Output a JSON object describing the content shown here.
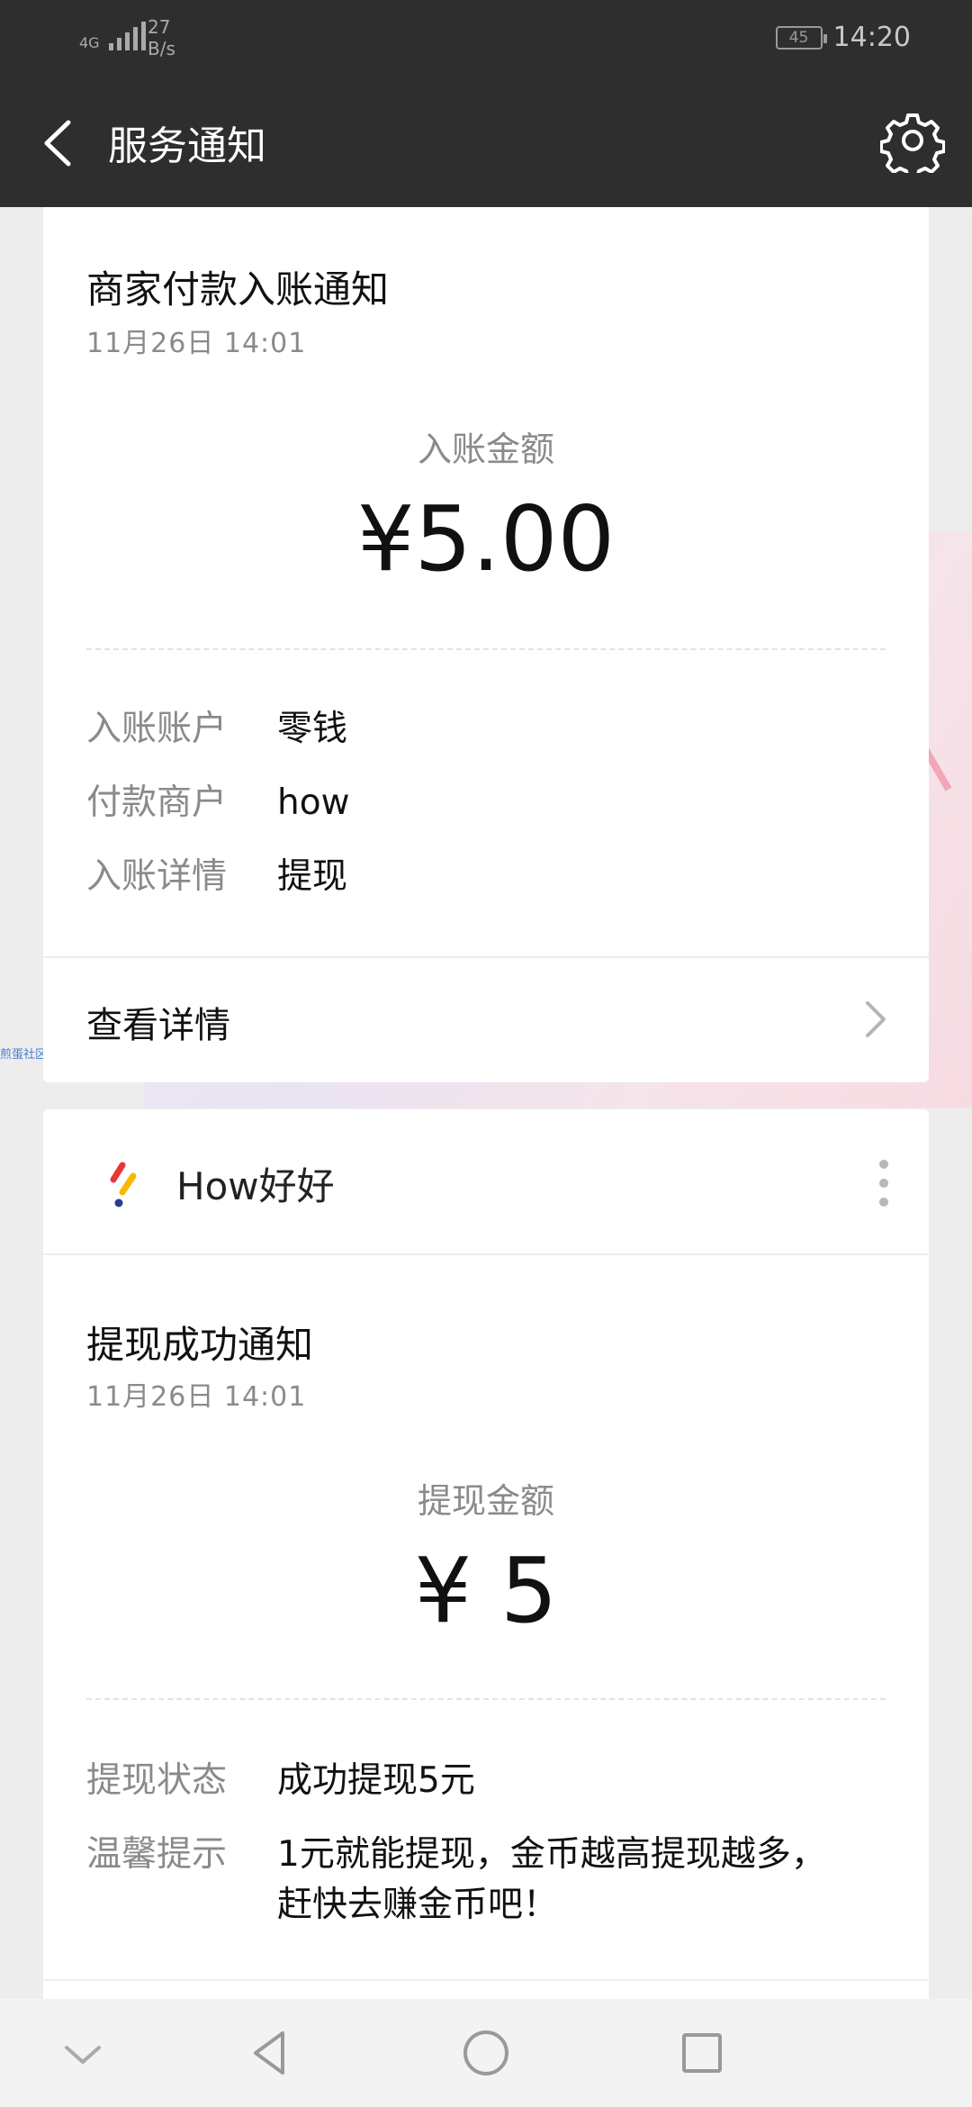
{
  "status_bar": {
    "network": "4G",
    "speed_value": "27",
    "speed_unit": "B/s",
    "battery": "45",
    "time": "14:20"
  },
  "header": {
    "title": "服务通知"
  },
  "card1": {
    "title": "商家付款入账通知",
    "date": "11月26日  14:01",
    "amount_label": "入账金额",
    "amount": "¥5.00",
    "fields": [
      {
        "key": "入账账户",
        "value": "零钱"
      },
      {
        "key": "付款商户",
        "value": "how"
      },
      {
        "key": "入账详情",
        "value": "提现"
      }
    ],
    "detail_link": "查看详情"
  },
  "card2": {
    "brand": "How好好",
    "title": "提现成功通知",
    "date": "11月26日  14:01",
    "amount_label": "提现金额",
    "amount": "¥ 5",
    "fields": [
      {
        "key": "提现状态",
        "value": "成功提现5元"
      },
      {
        "key": "温馨提示",
        "value": "1元就能提现，金币越高提现越多，赶快去赚金币吧！"
      }
    ]
  },
  "watermark": "煎蛋社区",
  "colors": {
    "header_bg": "#2e2e2e",
    "page_bg": "#ededed",
    "muted_text": "#8a8a8a"
  },
  "icons": [
    "back-arrow-icon",
    "gear-icon",
    "chevron-right-icon",
    "more-vertical-icon",
    "brand-logo-icon",
    "nav-down-icon",
    "nav-back-icon",
    "nav-home-icon",
    "nav-recents-icon"
  ]
}
